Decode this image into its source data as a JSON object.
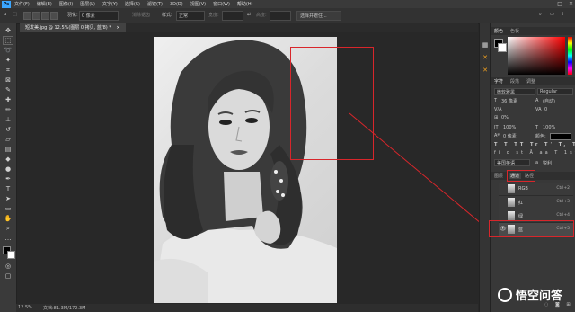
{
  "menubar": {
    "app_icon": "Ps",
    "items": [
      "文件(F)",
      "编辑(E)",
      "图像(I)",
      "图层(L)",
      "文字(Y)",
      "选择(S)",
      "滤镜(T)",
      "3D(D)",
      "视图(V)",
      "窗口(W)",
      "帮助(H)"
    ],
    "window_controls": [
      "—",
      "□",
      "✕"
    ]
  },
  "options": {
    "feather_label": "羽化:",
    "feather_value": "0 像素",
    "antialias_label": "消除锯齿",
    "style_label": "样式:",
    "style_value": "正常",
    "width_label": "宽度:",
    "height_label": "高度:",
    "select_mask_label": "选择并遮住..."
  },
  "document": {
    "tab_title": "短发美.jpg @ 12.5%(图层 0 拷贝, 蓝/8) *",
    "close": "×"
  },
  "status": {
    "zoom": "12.5%",
    "doc_info": "文档:81.3M/172.3M"
  },
  "panels": {
    "color_tabs": [
      "颜色",
      "色板"
    ],
    "char_tabs": [
      "字符",
      "段落",
      "调整"
    ],
    "font_family": "微软雅黑",
    "font_style": "Regular",
    "font_size": "36 像素",
    "leading": "(自动)",
    "kerning": "0%",
    "tracking": "0",
    "vscale": "100%",
    "hscale": "100%",
    "baseline": "0 像素",
    "color_label": "颜色:",
    "language": "美国英语",
    "aa": "a",
    "aa_mode": "锐利",
    "layer_tabs": [
      "图层",
      "通道",
      "路径"
    ],
    "channels": [
      {
        "name": "RGB",
        "key": "Ctrl+2"
      },
      {
        "name": "红",
        "key": "Ctrl+3"
      },
      {
        "name": "绿",
        "key": "Ctrl+4"
      },
      {
        "name": "蓝",
        "key": "Ctrl+5"
      }
    ]
  },
  "watermark": "悟空问答",
  "colors": {
    "highlight_red": "#d8262b"
  }
}
